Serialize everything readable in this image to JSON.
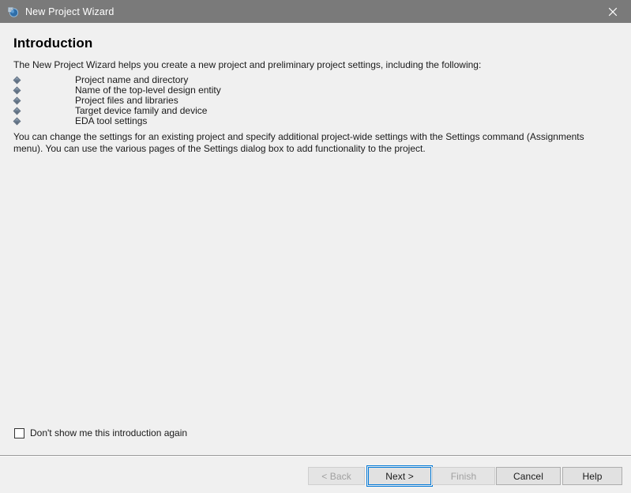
{
  "window": {
    "title": "New Project Wizard",
    "icon": "wizard-icon",
    "close_icon": "close-icon",
    "titlebar_color": "#7a7a7a",
    "background_color": "#f0f0f0"
  },
  "page": {
    "heading": "Introduction",
    "intro_paragraph": "The New Project Wizard helps you create a new project and preliminary project settings, including the following:",
    "bullets": [
      {
        "label": "Project name and directory"
      },
      {
        "label": "Name of the top-level design entity"
      },
      {
        "label": "Project files and libraries"
      },
      {
        "label": "Target device family and device"
      },
      {
        "label": "EDA tool settings"
      }
    ],
    "body_paragraph": "You can change the settings for an existing project and specify additional project-wide settings with the Settings command (Assignments menu). You can use the various pages of the Settings dialog box to add functionality to the project."
  },
  "checkbox": {
    "label": "Don't show me this introduction again",
    "checked": false
  },
  "footer": {
    "buttons": [
      {
        "label": "< Back",
        "enabled": false,
        "focused": false
      },
      {
        "label": "Next >",
        "enabled": true,
        "focused": true
      },
      {
        "label": "Finish",
        "enabled": false,
        "focused": false
      },
      {
        "label": "Cancel",
        "enabled": true,
        "focused": false
      },
      {
        "label": "Help",
        "enabled": true,
        "focused": false
      }
    ],
    "focus_color": "#0078d7"
  }
}
